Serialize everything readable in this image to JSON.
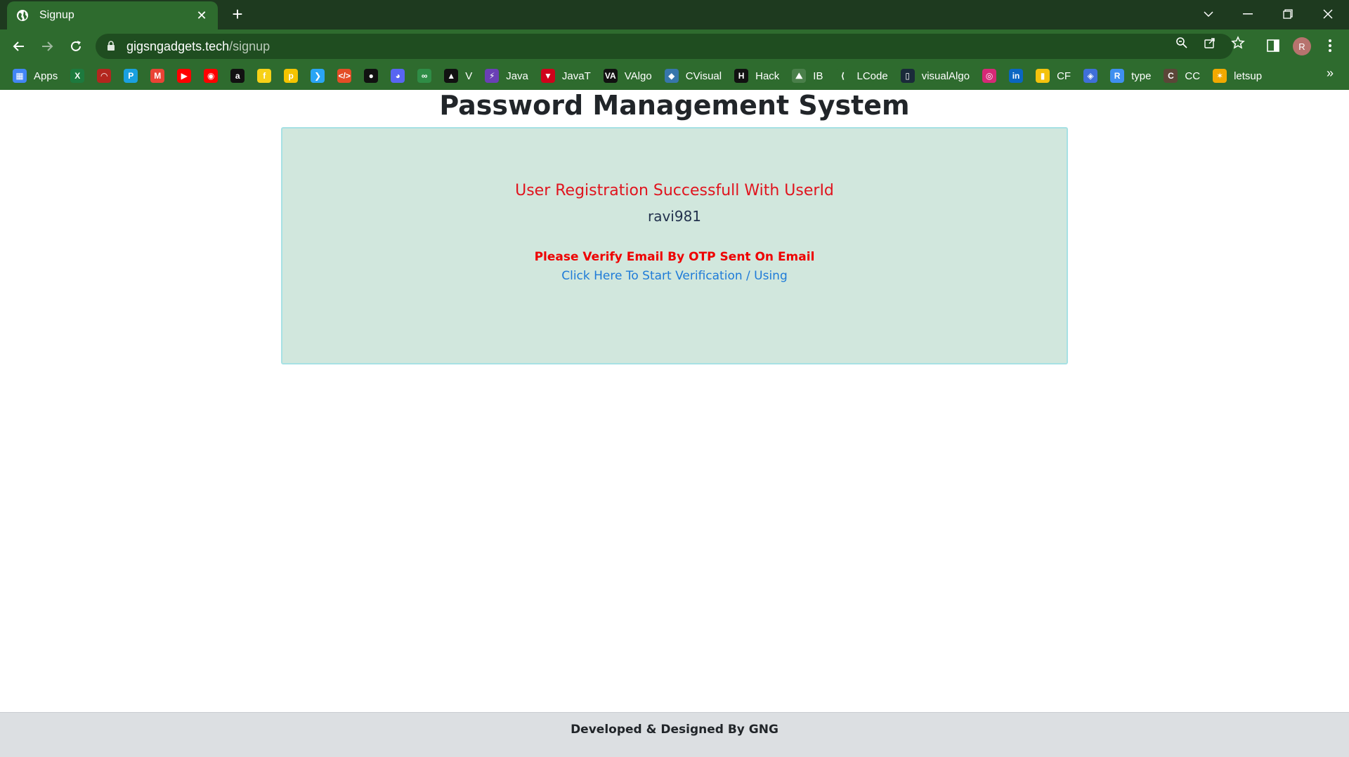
{
  "browser": {
    "tab_title": "Signup",
    "new_tab_symbol": "+",
    "close_symbol": "✕",
    "url_domain": "gigsngadgets.tech",
    "url_path": "/signup",
    "profile_initial": "R"
  },
  "bookmarks": [
    {
      "label": "Apps",
      "icon": "apps-grid-icon",
      "color": "#4285f4"
    },
    {
      "label": "",
      "icon": "excel-icon",
      "color": "#1d7a3e"
    },
    {
      "label": "",
      "icon": "speedometer-icon",
      "color": "#b3261e"
    },
    {
      "label": "",
      "icon": "paytm-icon",
      "color": "#1aa0e0"
    },
    {
      "label": "",
      "icon": "gmail-icon",
      "color": "#ea4335"
    },
    {
      "label": "",
      "icon": "youtube-icon",
      "color": "#ff0000"
    },
    {
      "label": "",
      "icon": "youtube-music-icon",
      "color": "#ff0000"
    },
    {
      "label": "",
      "icon": "amazon-icon",
      "color": "#111111"
    },
    {
      "label": "",
      "icon": "flipkart-icon",
      "color": "#f7d117"
    },
    {
      "label": "",
      "icon": "p-icon",
      "color": "#f5c400"
    },
    {
      "label": "",
      "icon": "arrow-icon",
      "color": "#2aa5f5"
    },
    {
      "label": "",
      "icon": "code-icon",
      "color": "#e44d26"
    },
    {
      "label": "",
      "icon": "github-icon",
      "color": "#111111"
    },
    {
      "label": "",
      "icon": "discord-icon",
      "color": "#5865f2"
    },
    {
      "label": "",
      "icon": "geeks-icon",
      "color": "#2f8d46"
    },
    {
      "label": "V",
      "icon": "v-triangle-icon",
      "color": "#111111"
    },
    {
      "label": "Java",
      "icon": "bolt-icon",
      "color": "#6a3fb5"
    },
    {
      "label": "JavaT",
      "icon": "javat-icon",
      "color": "#d0021b"
    },
    {
      "label": "VAlgo",
      "icon": "va-icon",
      "color": "#111111"
    },
    {
      "label": "CVisual",
      "icon": "python-icon",
      "color": "#3776ab"
    },
    {
      "label": "Hack",
      "icon": "hackerrank-icon",
      "color": "#111111"
    },
    {
      "label": "IB",
      "icon": "mountain-icon",
      "color": "#4a7f4a"
    },
    {
      "label": "LCode",
      "icon": "leetcode-icon",
      "color": "#2e6b2e"
    },
    {
      "label": "visualAlgo",
      "icon": "visualalgo-icon",
      "color": "#1a2a3a"
    },
    {
      "label": "",
      "icon": "instagram-icon",
      "color": "#d62976"
    },
    {
      "label": "",
      "icon": "linkedin-icon",
      "color": "#0a66c2"
    },
    {
      "label": "CF",
      "icon": "codeforces-icon",
      "color": "#f4c20d"
    },
    {
      "label": "",
      "icon": "diamond-icon",
      "color": "#3f6fd8"
    },
    {
      "label": "type",
      "icon": "typeracer-icon",
      "color": "#3f8ff0"
    },
    {
      "label": "CC",
      "icon": "codechef-icon",
      "color": "#5b4638"
    },
    {
      "label": "letsup",
      "icon": "letsup-icon",
      "color": "#f2a900"
    }
  ],
  "page": {
    "title": "Password Management System",
    "success_message": "User Registration Successfull With UserId",
    "user_id": "ravi981",
    "verify_message": "Please Verify Email By OTP Sent On Email",
    "verify_link": "Click Here To Start Verification / Using",
    "footer": "Developed & Designed By GNG"
  },
  "colors": {
    "chrome": "#2e6b2e",
    "card_bg": "#d1e7dd",
    "success_text": "#e0141e",
    "link": "#1e7bd8"
  }
}
